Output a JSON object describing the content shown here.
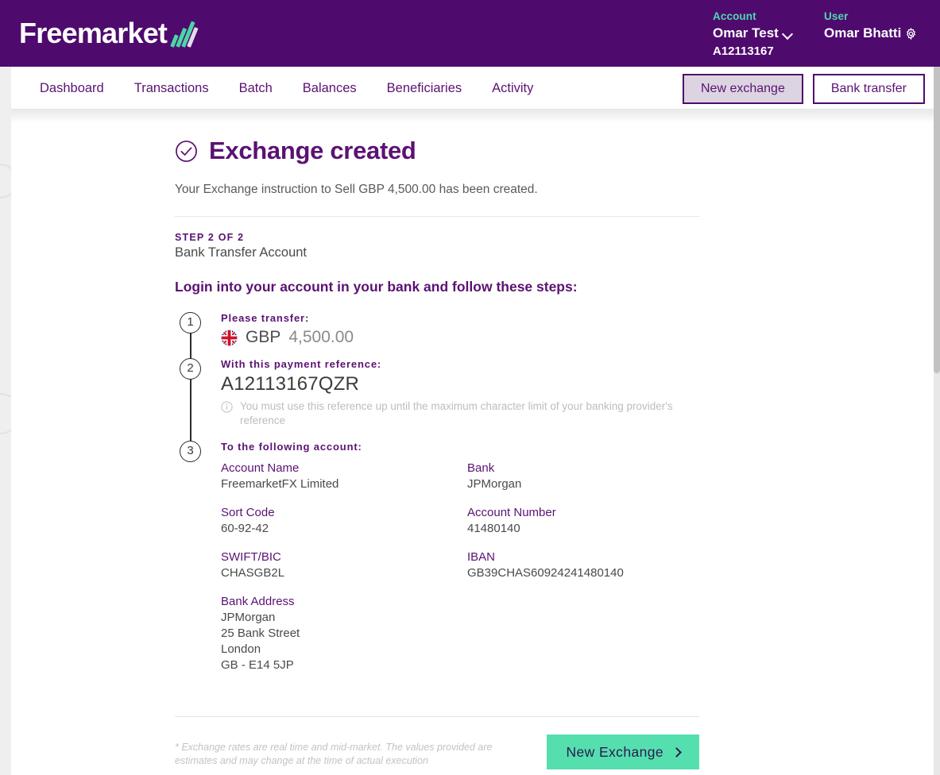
{
  "brand": {
    "name": "Freemarket",
    "accent_purple": "#4f0a6e",
    "accent_teal": "#4fd8b0",
    "accent_mint": "#55dfae"
  },
  "header": {
    "account": {
      "label": "Account",
      "name": "Omar Test",
      "number": "A12113167"
    },
    "user": {
      "label": "User",
      "name": "Omar Bhatti"
    }
  },
  "nav": {
    "links": [
      {
        "label": "Dashboard"
      },
      {
        "label": "Transactions"
      },
      {
        "label": "Batch"
      },
      {
        "label": "Balances"
      },
      {
        "label": "Beneficiaries"
      },
      {
        "label": "Activity"
      }
    ],
    "buttons": [
      {
        "label": "New exchange",
        "active": true
      },
      {
        "label": "Bank transfer",
        "active": false
      }
    ]
  },
  "main": {
    "title": "Exchange created",
    "subtitle": "Your Exchange instruction to Sell GBP 4,500.00 has been created.",
    "step_label": "STEP 2 OF 2",
    "step_sub": "Bank Transfer Account",
    "instruction": "Login into your account in your bank and follow these steps:",
    "steps": [
      {
        "number": "1",
        "head": "Please transfer:",
        "currency": "GBP",
        "amount": "4,500.00",
        "flag": "gb-flag-icon"
      },
      {
        "number": "2",
        "head": "With this payment reference:",
        "reference": "A12113167QZR",
        "note": "You must use this reference up until the maximum character limit of your banking provider's reference"
      },
      {
        "number": "3",
        "head": "To the following account:",
        "fields": [
          {
            "label": "Account Name",
            "value": "FreemarketFX Limited"
          },
          {
            "label": "Bank",
            "value": "JPMorgan"
          },
          {
            "label": "Sort Code",
            "value": "60-92-42"
          },
          {
            "label": "Account Number",
            "value": "41480140"
          },
          {
            "label": "SWIFT/BIC",
            "value": "CHASGB2L"
          },
          {
            "label": "IBAN",
            "value": "GB39CHAS60924241480140"
          }
        ],
        "bank_address": {
          "label": "Bank Address",
          "lines": [
            "JPMorgan",
            "25 Bank Street",
            "London",
            "GB - E14 5JP"
          ]
        }
      }
    ]
  },
  "footer": {
    "disclaimer": "* Exchange rates are real time and mid-market. The values provided are estimates and may change at the time of actual execution",
    "cta_label": "New Exchange"
  }
}
